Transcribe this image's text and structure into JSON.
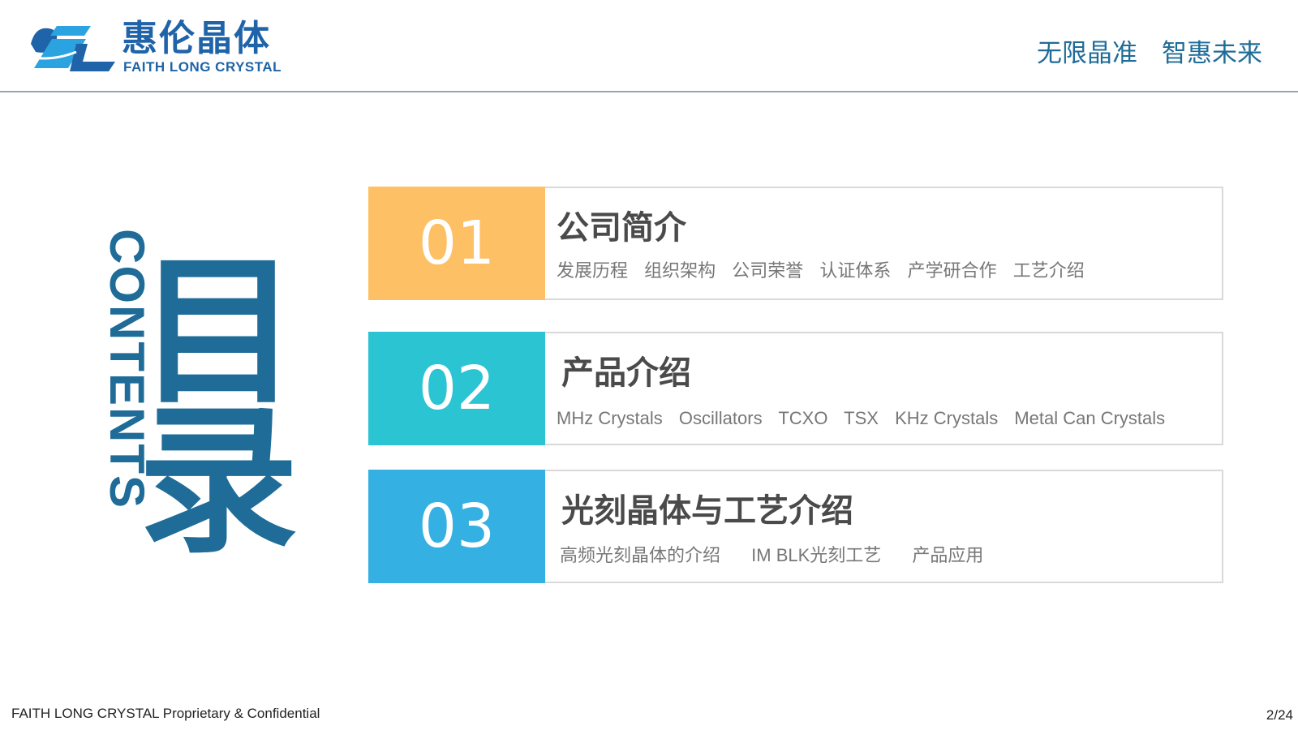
{
  "header": {
    "logo_cn": "惠伦晶体",
    "logo_en": "FAITH LONG CRYSTAL",
    "slogan_1": "无限晶准",
    "slogan_2": "智惠未来"
  },
  "title": {
    "vertical_en": "CONTENTS",
    "big_cn": "目录"
  },
  "items": [
    {
      "number": "01",
      "title": "公司简介",
      "color": "#fec064",
      "subs": [
        "发展历程",
        "组织架构",
        "公司荣誉",
        "认证体系",
        "产学研合作",
        "工艺介绍"
      ]
    },
    {
      "number": "02",
      "title": "产品介绍",
      "color": "#2bc4d2",
      "subs": [
        "MHz Crystals",
        "Oscillators",
        "TCXO",
        "TSX",
        "KHz Crystals",
        "Metal Can Crystals"
      ]
    },
    {
      "number": "03",
      "title": "光刻晶体与工艺介绍",
      "color": "#34b0e3",
      "subs": [
        "高频光刻晶体的介绍",
        "IM BLK光刻工艺",
        "产品应用"
      ]
    }
  ],
  "footer": {
    "left": "FAITH LONG CRYSTAL Proprietary & Confidential",
    "page": "2/24"
  },
  "colors": {
    "brand_blue": "#1f6c98",
    "logo_blue": "#1f63a8",
    "logo_light": "#2aa3e0"
  }
}
